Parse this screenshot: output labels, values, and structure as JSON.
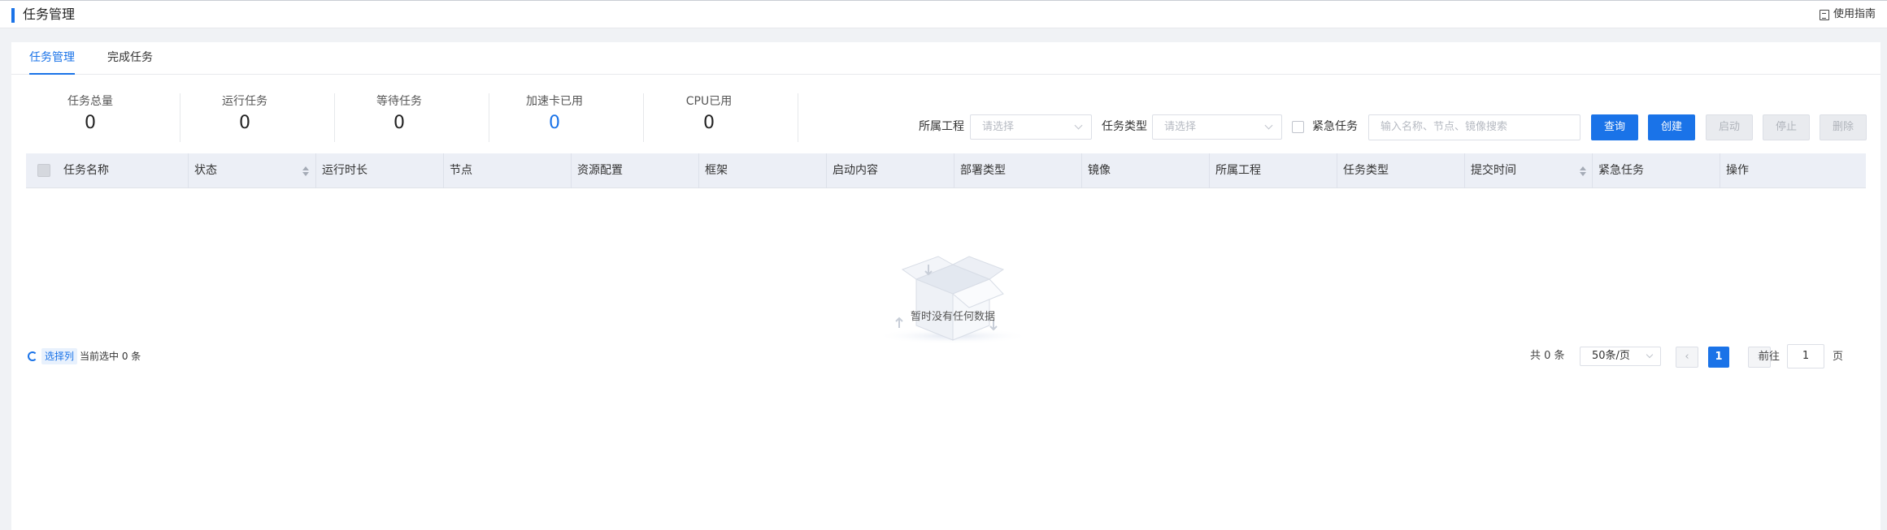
{
  "header": {
    "title": "任务管理",
    "guide_label": "使用指南"
  },
  "tabs": [
    {
      "label": "任务管理",
      "active": true
    },
    {
      "label": "完成任务",
      "active": false
    }
  ],
  "stats": [
    {
      "label": "任务总量",
      "value": "0"
    },
    {
      "label": "运行任务",
      "value": "0"
    },
    {
      "label": "等待任务",
      "value": "0"
    },
    {
      "label": "加速卡已用",
      "value": "0"
    },
    {
      "label": "CPU已用",
      "value": "0"
    }
  ],
  "filters": {
    "project_label": "所属工程",
    "project_placeholder": "请选择",
    "type_label": "任务类型",
    "type_placeholder": "请选择",
    "urgent_label": "紧急任务",
    "search_placeholder": "输入名称、节点、镜像搜索"
  },
  "buttons": {
    "query": "查询",
    "create": "创建",
    "start": "启动",
    "stop": "停止",
    "delete": "删除"
  },
  "table": {
    "columns": [
      "任务名称",
      "状态",
      "运行时长",
      "节点",
      "资源配置",
      "框架",
      "启动内容",
      "部署类型",
      "镜像",
      "所属工程",
      "任务类型",
      "提交时间",
      "紧急任务",
      "操作"
    ],
    "empty_text": "暂时没有任何数据"
  },
  "footer": {
    "pick_columns": "选择列",
    "selected_text": "当前选中 0 条",
    "total_text": "共 0 条",
    "page_size": "50条/页",
    "current_page": "1",
    "goto_prefix": "前往",
    "goto_value": "1",
    "goto_suffix": "页"
  },
  "colors": {
    "accent": "#1a73e8",
    "table_header_bg": "#eceff6"
  }
}
